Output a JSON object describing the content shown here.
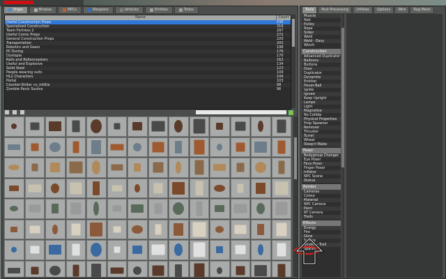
{
  "left_tabs": [
    {
      "label": "Props",
      "color": "#4a90d0"
    },
    {
      "label": "Browse",
      "color": "#b0b0b0"
    },
    {
      "label": "NPCs",
      "color": "#c06030"
    },
    {
      "label": "Weapons",
      "color": "#3070c0"
    },
    {
      "label": "Vehicles",
      "color": "#808080"
    },
    {
      "label": "Entities",
      "color": "#a0a0a0"
    },
    {
      "label": "Todos",
      "color": "#a0a0a0"
    }
  ],
  "list": {
    "col_name": "Name",
    "col_count": "Count",
    "rows": [
      {
        "name": "Useful Construction Props",
        "count": "536"
      },
      {
        "name": "Specialized Construction",
        "count": "316"
      },
      {
        "name": "Team Fortress 2",
        "count": "297"
      },
      {
        "name": "Useful Comic Props",
        "count": "272"
      },
      {
        "name": "General Construction Props",
        "count": "220"
      },
      {
        "name": "Transportation",
        "count": "205"
      },
      {
        "name": "Robotics and Gears",
        "count": "198"
      },
      {
        "name": "PC-Tuning",
        "count": "176"
      },
      {
        "name": "Dystopia",
        "count": "170"
      },
      {
        "name": "Rails and Rollercoasters",
        "count": "162"
      },
      {
        "name": "Useful and Explosive",
        "count": "134"
      },
      {
        "name": "Solid Steel",
        "count": "123"
      },
      {
        "name": "People wearing suits",
        "count": "109"
      },
      {
        "name": "HL2 Characters",
        "count": "106"
      },
      {
        "name": "Portal",
        "count": "103"
      },
      {
        "name": "Counter-Strike: cs_militia",
        "count": "98"
      },
      {
        "name": "Zombie Panic Source",
        "count": "96"
      }
    ]
  },
  "right_tabs": [
    {
      "label": "Tools"
    },
    {
      "label": "Post Processing"
    },
    {
      "label": "Utilities"
    },
    {
      "label": "Options"
    },
    {
      "label": "Wire"
    },
    {
      "label": "Rag Mesh"
    }
  ],
  "tools": {
    "top": [
      "Muscle",
      "Nail",
      "Pulley",
      "Rope",
      "Slider",
      "Weld",
      "Weld - Easy",
      "Winch"
    ],
    "construction_title": "Construction",
    "construction": [
      "Advanced Duplicator",
      "Balloons",
      "Buttons",
      "Door",
      "Duplicator",
      "Dynamite",
      "Emitter",
      "Hover-Ball",
      "Ignite",
      "Ignore",
      "Keep Upright",
      "Lamps",
      "Light",
      "Magnetise",
      "No Collide",
      "Physical Properties",
      "Prop Spawner",
      "Remover",
      "Thruster",
      "Turret",
      "Wheel",
      "Sleep'n'Wake"
    ],
    "poser_title": "Poser",
    "poser": [
      "Bodygroup Changer",
      "Eye Poser",
      "Face Poser",
      "Finger Poser",
      "Inflator",
      "NPC Scene",
      "Statue"
    ],
    "render_title": "Render",
    "render": [
      "Cameras",
      "Colour",
      "Material",
      "NPC Camera",
      "Paint",
      "RT Camera",
      "Trails"
    ],
    "effects_title": "Effects",
    "effects": [
      "Energy",
      "Fire",
      "Glow",
      "Smoke",
      "Smoke - Trail",
      "Sparks"
    ]
  },
  "colors": {
    "selected_row": "#2f78d8",
    "annotation": "#e0201a"
  }
}
